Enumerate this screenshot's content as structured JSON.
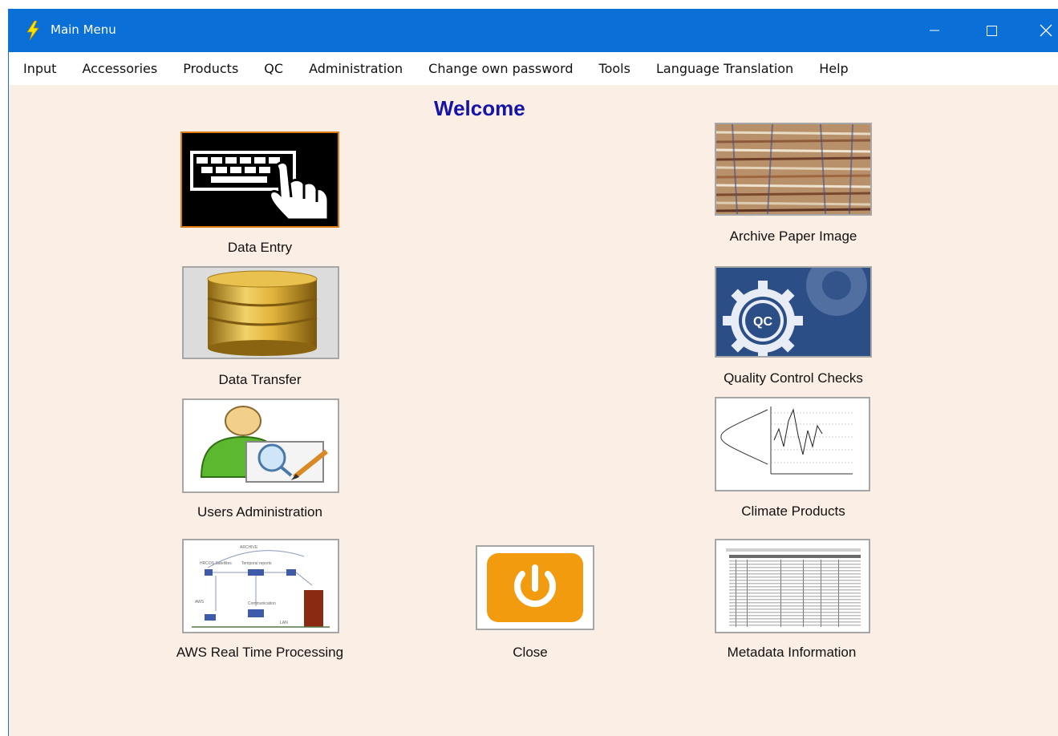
{
  "window": {
    "title": "Main Menu",
    "app_icon": "lightning-bolt-icon",
    "controls": [
      "minimize",
      "maximize",
      "close"
    ]
  },
  "menu": [
    "Input",
    "Accessories",
    "Products",
    "QC",
    "Administration",
    "Change own password",
    "Tools",
    "Language Translation",
    "Help"
  ],
  "welcome": "Welcome",
  "tiles": {
    "data_entry": {
      "label": "Data Entry",
      "icon": "keyboard-hand-icon"
    },
    "data_transfer": {
      "label": "Data Transfer",
      "icon": "database-icon"
    },
    "users_admin": {
      "label": "Users Administration",
      "icon": "user-admin-icon"
    },
    "aws": {
      "label": "AWS Real Time Processing",
      "icon": "network-diagram-icon"
    },
    "close": {
      "label": "Close",
      "icon": "power-icon"
    },
    "archive": {
      "label": "Archive Paper Image",
      "icon": "paper-archive-icon"
    },
    "qc": {
      "label": "Quality Control Checks",
      "icon": "qc-gear-icon",
      "badge": "QC"
    },
    "climate": {
      "label": "Climate Products",
      "icon": "climate-chart-icon"
    },
    "metadata": {
      "label": "Metadata Information",
      "icon": "metadata-table-icon"
    }
  },
  "colors": {
    "titlebar": "#0a6fd6",
    "background": "#faeee5",
    "welcome": "#1414a8",
    "close_orange": "#f29b0f"
  }
}
